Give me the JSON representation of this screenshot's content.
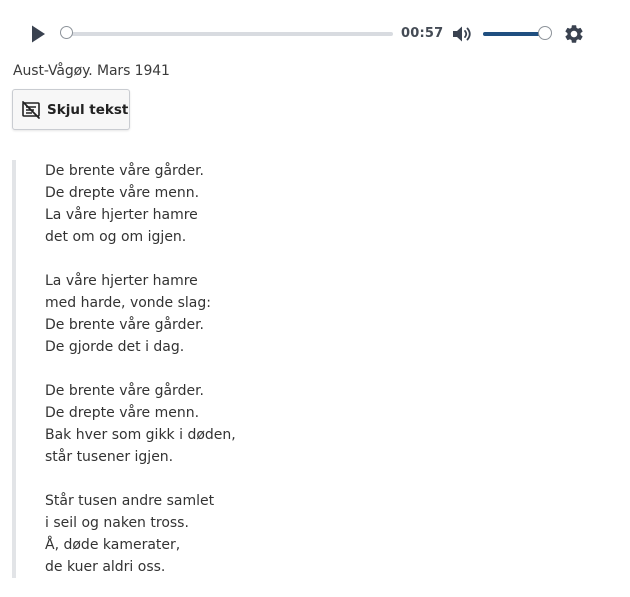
{
  "player": {
    "time": "00:57",
    "progress": 0.0,
    "volume": 1.0,
    "accent_color": "#1f4f80",
    "icons": {
      "play": "play-icon",
      "volume": "volume-icon",
      "settings": "gear-icon"
    }
  },
  "caption": "Aust-Vågøy. Mars 1941",
  "toggle_button": {
    "label": "Skjul tekst",
    "icon": "hide-text-icon"
  },
  "poem": {
    "stanzas": [
      [
        "De brente våre gårder.",
        "De drepte våre menn.",
        "La våre hjerter hamre",
        "det om og om igjen."
      ],
      [
        "La våre hjerter hamre",
        "med harde, vonde slag:",
        "De brente våre gårder.",
        "De gjorde det i dag."
      ],
      [
        "De brente våre gårder.",
        "De drepte våre menn.",
        "Bak hver som gikk i døden,",
        "står tusener igjen."
      ],
      [
        "Står tusen andre samlet",
        "i seil og naken tross.",
        "Å, døde kamerater,",
        "de kuer aldri oss."
      ]
    ]
  }
}
